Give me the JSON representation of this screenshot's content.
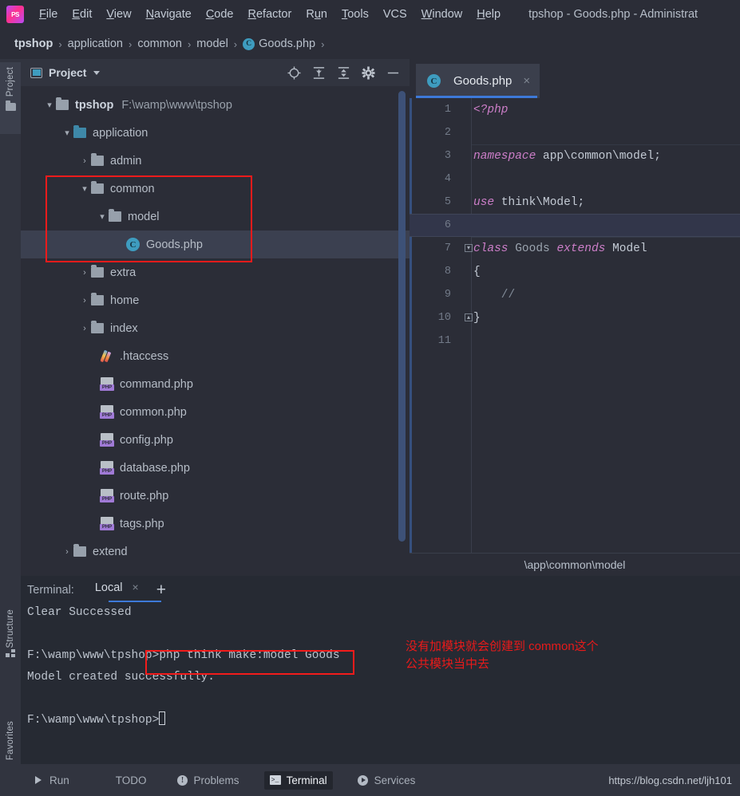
{
  "window": {
    "title": "tpshop - Goods.php - Administrat",
    "logo": "phpstorm-logo"
  },
  "menu": {
    "items": [
      {
        "label": "File",
        "mnemonic": "F"
      },
      {
        "label": "Edit",
        "mnemonic": "E"
      },
      {
        "label": "View",
        "mnemonic": "V"
      },
      {
        "label": "Navigate",
        "mnemonic": "N"
      },
      {
        "label": "Code",
        "mnemonic": "C"
      },
      {
        "label": "Refactor",
        "mnemonic": "R"
      },
      {
        "label": "Run",
        "mnemonic": "u"
      },
      {
        "label": "Tools",
        "mnemonic": "T"
      },
      {
        "label": "VCS",
        "mnemonic": ""
      },
      {
        "label": "Window",
        "mnemonic": "W"
      },
      {
        "label": "Help",
        "mnemonic": "H"
      }
    ]
  },
  "breadcrumb": {
    "separator": "›",
    "items": [
      {
        "label": "tpshop",
        "bold": true,
        "icon": ""
      },
      {
        "label": "application",
        "bold": false,
        "icon": ""
      },
      {
        "label": "common",
        "bold": false,
        "icon": ""
      },
      {
        "label": "model",
        "bold": false,
        "icon": ""
      },
      {
        "label": "Goods.php",
        "bold": false,
        "icon": "class-badge"
      }
    ]
  },
  "toolstrip": {
    "project": "Project",
    "structure": "Structure",
    "favorites": "Favorites"
  },
  "project_panel": {
    "title": "Project",
    "icons": [
      "locate-icon",
      "expand-all-icon",
      "collapse-all-icon",
      "gear-icon",
      "hide-icon"
    ],
    "tree": [
      {
        "indent": 0,
        "arrow": "∨",
        "icon": "folder",
        "label": "tpshop",
        "bold": true,
        "path": "F:\\wamp\\www\\tpshop",
        "selected": false
      },
      {
        "indent": 1,
        "arrow": "∨",
        "icon": "folder-blue",
        "label": "application",
        "bold": false,
        "path": "",
        "selected": false
      },
      {
        "indent": 2,
        "arrow": "›",
        "icon": "folder",
        "label": "admin",
        "bold": false,
        "path": "",
        "selected": false
      },
      {
        "indent": 2,
        "arrow": "∨",
        "icon": "folder",
        "label": "common",
        "bold": false,
        "path": "",
        "selected": false
      },
      {
        "indent": 3,
        "arrow": "∨",
        "icon": "folder",
        "label": "model",
        "bold": false,
        "path": "",
        "selected": false
      },
      {
        "indent": 4,
        "arrow": "",
        "icon": "class",
        "label": "Goods.php",
        "bold": false,
        "path": "",
        "selected": true
      },
      {
        "indent": 2,
        "arrow": "›",
        "icon": "folder",
        "label": "extra",
        "bold": false,
        "path": "",
        "selected": false
      },
      {
        "indent": 2,
        "arrow": "›",
        "icon": "folder",
        "label": "home",
        "bold": false,
        "path": "",
        "selected": false
      },
      {
        "indent": 2,
        "arrow": "›",
        "icon": "folder",
        "label": "index",
        "bold": false,
        "path": "",
        "selected": false
      },
      {
        "indent": 3,
        "arrow": "",
        "icon": "htaccess",
        "label": ".htaccess",
        "bold": false,
        "path": "",
        "selected": false
      },
      {
        "indent": 3,
        "arrow": "",
        "icon": "php",
        "label": "command.php",
        "bold": false,
        "path": "",
        "selected": false
      },
      {
        "indent": 3,
        "arrow": "",
        "icon": "php",
        "label": "common.php",
        "bold": false,
        "path": "",
        "selected": false
      },
      {
        "indent": 3,
        "arrow": "",
        "icon": "php",
        "label": "config.php",
        "bold": false,
        "path": "",
        "selected": false
      },
      {
        "indent": 3,
        "arrow": "",
        "icon": "php",
        "label": "database.php",
        "bold": false,
        "path": "",
        "selected": false
      },
      {
        "indent": 3,
        "arrow": "",
        "icon": "php",
        "label": "route.php",
        "bold": false,
        "path": "",
        "selected": false
      },
      {
        "indent": 3,
        "arrow": "",
        "icon": "php",
        "label": "tags.php",
        "bold": false,
        "path": "",
        "selected": false
      },
      {
        "indent": 1,
        "arrow": "›",
        "icon": "folder",
        "label": "extend",
        "bold": false,
        "path": "",
        "selected": false
      }
    ]
  },
  "editor": {
    "tab": {
      "label": "Goods.php",
      "icon": "class-badge",
      "close": "×"
    },
    "status_path": "\\app\\common\\model",
    "current_line": 6,
    "lines": [
      {
        "n": 1,
        "tokens": [
          {
            "t": "<?php",
            "c": "kw"
          }
        ]
      },
      {
        "n": 2,
        "tokens": []
      },
      {
        "n": 3,
        "tokens": [
          {
            "t": "namespace ",
            "c": "kw"
          },
          {
            "t": "app\\common\\model;",
            "c": "plain"
          }
        ]
      },
      {
        "n": 4,
        "tokens": []
      },
      {
        "n": 5,
        "tokens": [
          {
            "t": "use ",
            "c": "kw"
          },
          {
            "t": "think\\Model;",
            "c": "plain"
          }
        ]
      },
      {
        "n": 6,
        "tokens": []
      },
      {
        "n": 7,
        "tokens": [
          {
            "t": "class ",
            "c": "kw"
          },
          {
            "t": "Goods ",
            "c": "cls-name"
          },
          {
            "t": "extends ",
            "c": "kw"
          },
          {
            "t": "Model",
            "c": "plain"
          }
        ],
        "fold": "open"
      },
      {
        "n": 8,
        "tokens": [
          {
            "t": "{",
            "c": "plain"
          }
        ]
      },
      {
        "n": 9,
        "tokens": [
          {
            "t": "    //",
            "c": "cmt"
          }
        ]
      },
      {
        "n": 10,
        "tokens": [
          {
            "t": "}",
            "c": "plain"
          }
        ],
        "fold": "close"
      },
      {
        "n": 11,
        "tokens": []
      }
    ]
  },
  "terminal": {
    "label": "Terminal:",
    "tab": "Local",
    "tab_close": "×",
    "add": "+",
    "lines": [
      "Clear Successed",
      "",
      "F:\\wamp\\www\\tpshop>php think make:model Goods",
      "Model created successfully.",
      "",
      "F:\\wamp\\www\\tpshop>"
    ]
  },
  "annotation": {
    "text": "没有加模块就会创建到 common这个\n公共模块当中去",
    "color": "#e81a1a"
  },
  "bottom_bar": {
    "items": [
      {
        "label": "Run",
        "icon": "play-icon",
        "active": false
      },
      {
        "label": "TODO",
        "icon": "list-icon",
        "active": false
      },
      {
        "label": "Problems",
        "icon": "warning-icon",
        "active": false
      },
      {
        "label": "Terminal",
        "icon": "terminal-icon",
        "active": true
      },
      {
        "label": "Services",
        "icon": "services-icon",
        "active": false
      }
    ],
    "watermark": "https://blog.csdn.net/ljh101"
  },
  "colors": {
    "accent_blue": "#3d79d8",
    "highlight_red": "#f21b1b",
    "class_icon": "#3e9cbf",
    "bg_editor": "#2b2d37",
    "bg_panel": "#31343f",
    "bg_terminal": "#262a33"
  }
}
